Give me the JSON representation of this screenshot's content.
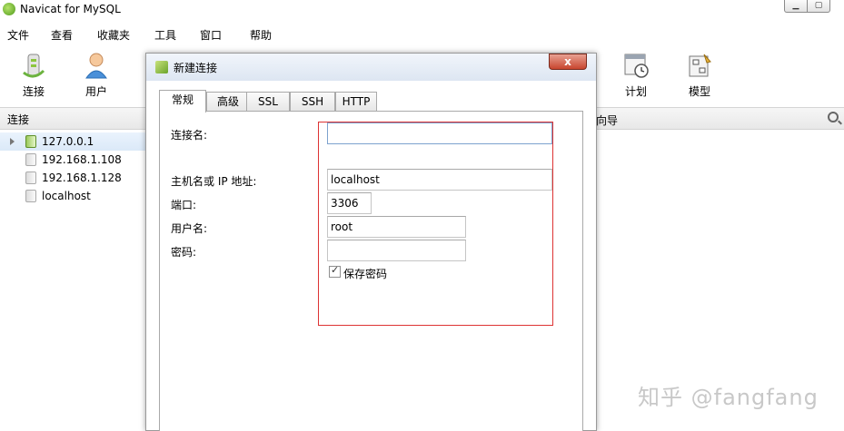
{
  "window": {
    "title": "Navicat for MySQL"
  },
  "menu": [
    "文件",
    "查看",
    "收藏夹",
    "工具",
    "窗口",
    "帮助"
  ],
  "toolbar": {
    "connect_label": "连接",
    "user_label": "用户",
    "schedule_label": "计划",
    "model_label": "模型"
  },
  "left_panel": {
    "header": "连接",
    "connections": [
      "127.0.0.1",
      "192.168.1.108",
      "192.168.1.128",
      "localhost"
    ]
  },
  "right_panel": {
    "header_partial": "向导"
  },
  "dialog": {
    "title": "新建连接",
    "close_label": "x",
    "tabs": [
      "常规",
      "高级",
      "SSL",
      "SSH",
      "HTTP"
    ],
    "active_tab": "常规",
    "fields": {
      "connection_name_label": "连接名:",
      "connection_name_value": "",
      "host_label": "主机名或 IP 地址:",
      "host_value": "localhost",
      "port_label": "端口:",
      "port_value": "3306",
      "username_label": "用户名:",
      "username_value": "root",
      "password_label": "密码:",
      "password_value": "",
      "save_password_label": "保存密码",
      "save_password_checked": true
    }
  },
  "watermark": "知乎 @fangfang"
}
